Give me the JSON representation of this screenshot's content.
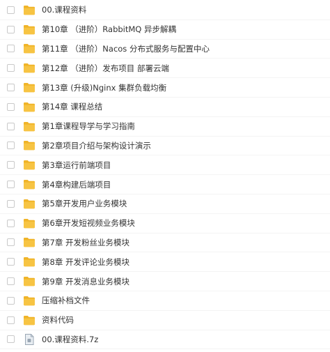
{
  "files": [
    {
      "name": "00.课程资料",
      "type": "folder",
      "icon": "folder-icon"
    },
    {
      "name": "第10章 （进阶）RabbitMQ 异步解耦",
      "type": "folder",
      "icon": "folder-icon"
    },
    {
      "name": "第11章 （进阶）Nacos 分布式服务与配置中心",
      "type": "folder",
      "icon": "folder-icon"
    },
    {
      "name": "第12章 （进阶）发布项目 部署云端",
      "type": "folder",
      "icon": "folder-icon"
    },
    {
      "name": "第13章 (升级)Nginx 集群负载均衡",
      "type": "folder",
      "icon": "folder-icon"
    },
    {
      "name": "第14章 课程总结",
      "type": "folder",
      "icon": "folder-icon"
    },
    {
      "name": "第1章课程导学与学习指南",
      "type": "folder",
      "icon": "folder-icon"
    },
    {
      "name": "第2章项目介绍与架构设计演示",
      "type": "folder",
      "icon": "folder-icon"
    },
    {
      "name": "第3章运行前端项目",
      "type": "folder",
      "icon": "folder-icon"
    },
    {
      "name": "第4章构建后端项目",
      "type": "folder",
      "icon": "folder-icon"
    },
    {
      "name": "第5章开发用户业务模块",
      "type": "folder",
      "icon": "folder-icon"
    },
    {
      "name": "第6章开发短视频业务模块",
      "type": "folder",
      "icon": "folder-icon"
    },
    {
      "name": "第7章 开发粉丝业务模块",
      "type": "folder",
      "icon": "folder-icon"
    },
    {
      "name": "第8章 开发评论业务模块",
      "type": "folder",
      "icon": "folder-icon"
    },
    {
      "name": "第9章 开发消息业务模块",
      "type": "folder",
      "icon": "folder-icon"
    },
    {
      "name": "压缩补档文件",
      "type": "folder",
      "icon": "folder-icon"
    },
    {
      "name": "资料代码",
      "type": "folder",
      "icon": "folder-icon"
    },
    {
      "name": "00.课程资料.7z",
      "type": "archive",
      "icon": "archive-file-icon"
    }
  ],
  "colors": {
    "folder": "#f7c443",
    "folder_tab": "#f0b429",
    "archive": "#9aa7b4"
  }
}
